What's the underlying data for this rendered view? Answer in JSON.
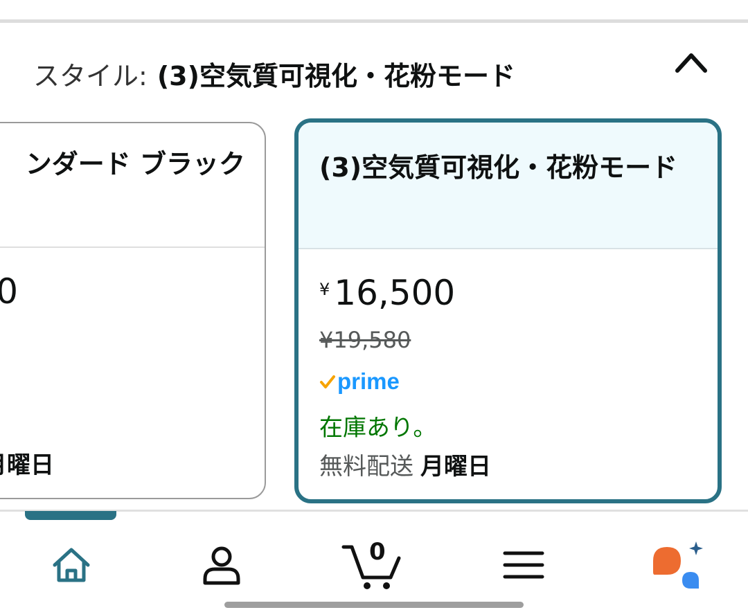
{
  "style_selector": {
    "label": "スタイル:",
    "value": "(3)空気質可視化・花粉モード"
  },
  "options": [
    {
      "name": "ンダード ブラック",
      "price": "0",
      "stock": "。",
      "delivery_day": "月曜日"
    },
    {
      "name": "(3)空気質可視化・花粉モード",
      "currency": "¥",
      "price": "16,500",
      "list_price": "¥19,580",
      "prime_label": "prime",
      "stock": "在庫あり。",
      "delivery_label": "無料配送",
      "delivery_day": "月曜日"
    }
  ],
  "nav": {
    "cart_count": "0",
    "items": [
      "home-icon",
      "account-icon",
      "cart-icon",
      "menu-icon",
      "rufus-icon"
    ],
    "active": "home"
  },
  "colors": {
    "accent": "#2a7285",
    "selected_bg": "#effafd",
    "in_stock": "#007600",
    "prime": "#1a98ff",
    "prime_check": "#f7a300",
    "assistant_orange": "#ed6c30",
    "assistant_blue": "#3a8cf0"
  }
}
